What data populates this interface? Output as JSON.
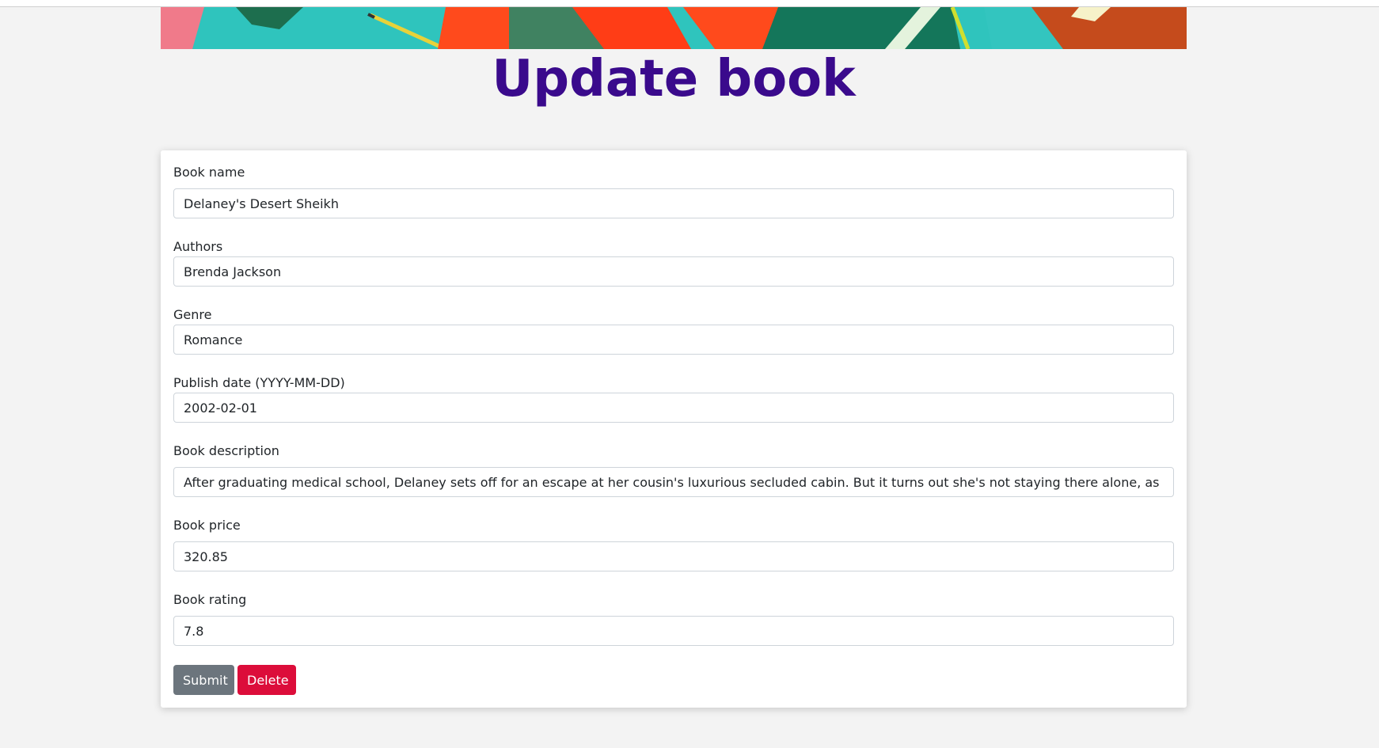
{
  "page": {
    "title": "Update book"
  },
  "form": {
    "fields": [
      {
        "label": "Book name",
        "value": "Delaney's Desert Sheikh"
      },
      {
        "label": "Authors",
        "value": "Brenda Jackson"
      },
      {
        "label": "Genre",
        "value": "Romance"
      },
      {
        "label": "Publish date (YYYY-MM-DD)",
        "value": "2002-02-01"
      },
      {
        "label": "Book description",
        "value": "After graduating medical school, Delaney sets off for an escape at her cousin's luxurious secluded cabin. But it turns out she's not staying there alone, as it's also occupied b"
      },
      {
        "label": "Book price",
        "value": "320.85"
      },
      {
        "label": "Book rating",
        "value": "7.8"
      }
    ],
    "submit_label": "Submit",
    "delete_label": "Delete"
  },
  "colors": {
    "title": "#3a0a8c",
    "submit_button": "#6c757d",
    "delete_button": "#dc0d3a",
    "background": "#f3f3f3"
  }
}
